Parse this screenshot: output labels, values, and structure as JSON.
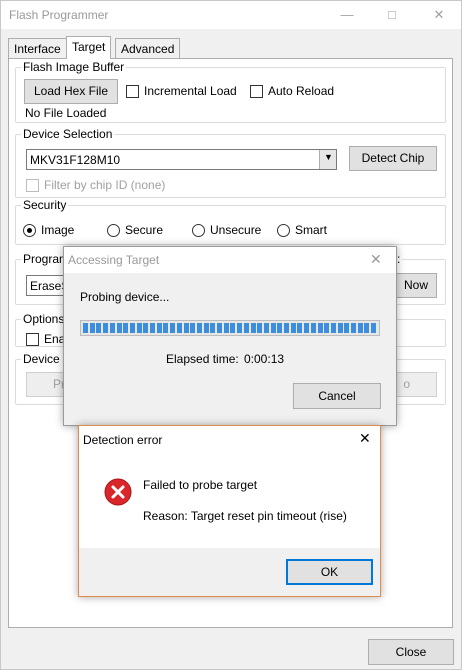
{
  "main": {
    "title": "Flash Programmer",
    "tabs": [
      "Interface",
      "Target",
      "Advanced"
    ],
    "flash_image_buffer": {
      "label": "Flash Image Buffer",
      "load_button": "Load Hex File",
      "incremental_load": "Incremental Load",
      "auto_reload": "Auto Reload",
      "status": "No File Loaded"
    },
    "device_selection": {
      "label": "Device Selection",
      "device": "MKV31F128M10",
      "detect_button": "Detect Chip",
      "filter_label": "Filter by chip ID (none)"
    },
    "security": {
      "label": "Security",
      "options": [
        "Image",
        "Secure",
        "Unsecure",
        "Smart"
      ],
      "selected": "Image"
    },
    "program_partial": {
      "label": "Program",
      "label_right": ":",
      "value": "EraseSe",
      "button": "Now"
    },
    "options_partial": {
      "label": "Options",
      "check_label": "Ena"
    },
    "device_partial": {
      "label": "Device C",
      "button_left": "Pr",
      "button_right": "o"
    },
    "close_button": "Close"
  },
  "accessing_dialog": {
    "title": "Accessing Target",
    "message": "Probing device...",
    "progress_segments": 44,
    "elapsed_label": "Elapsed time:",
    "elapsed_value": "0:00:13",
    "cancel_button": "Cancel"
  },
  "error_dialog": {
    "title": "Detection error",
    "message": "Failed to probe target",
    "reason": "Reason: Target reset pin timeout (rise)",
    "ok_button": "OK",
    "icon": "error-icon"
  },
  "colors": {
    "progress_fill": "#3c8ddc",
    "error_red": "#d9262a",
    "focus_blue": "#0078d7",
    "error_dialog_border": "#e08a4c"
  }
}
